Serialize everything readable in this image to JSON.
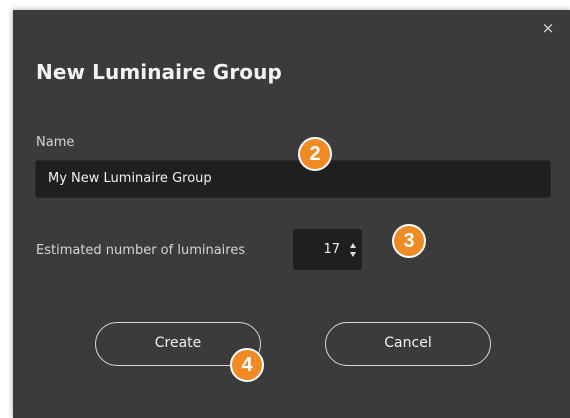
{
  "dialog": {
    "title": "New Luminaire Group",
    "close_icon": "×",
    "name_label": "Name",
    "name_value": "My New Luminaire Group",
    "count_label": "Estimated number of luminaires",
    "count_value": "17",
    "create_label": "Create",
    "cancel_label": "Cancel"
  },
  "badges": {
    "b2": "2",
    "b3": "3",
    "b4": "4"
  },
  "colors": {
    "dialog_bg": "#3b3b3b",
    "input_bg": "#1f1f1f",
    "badge": "#f08a24"
  },
  "icons": {
    "close": "close-icon",
    "spin_up": "chevron-up-icon",
    "spin_down": "chevron-down-icon"
  }
}
